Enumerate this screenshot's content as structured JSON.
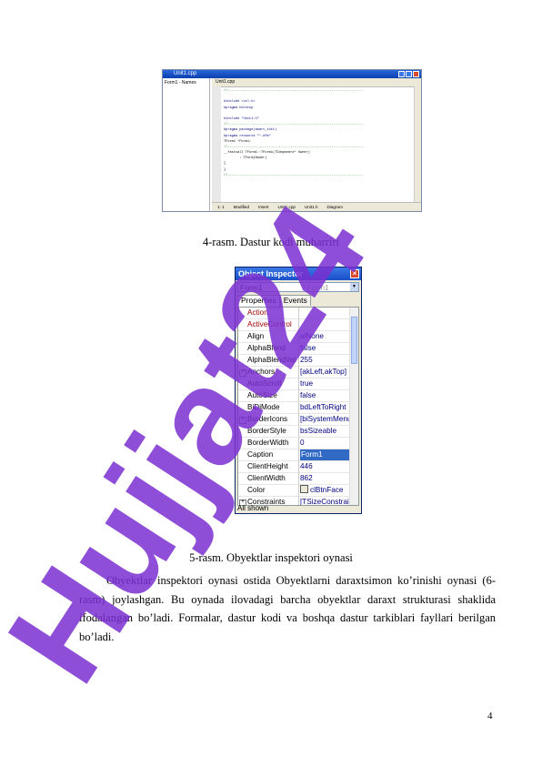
{
  "figure4": {
    "window_title": "Unit1.cpp",
    "tree_item": "Form1 - Names",
    "tab_label": "Unit1.cpp",
    "code_lines": [
      "//---------------------------------------------------------------------",
      "",
      "#include <vcl.h>",
      "#pragma hdrstop",
      "",
      "#include \"Unit1.h\"",
      "//---------------------------------------------------------------------",
      "#pragma package(smart_init)",
      "#pragma resource \"*.dfm\"",
      "TForm1 *Form1;",
      "//---------------------------------------------------------------------",
      "__fastcall TForm1::TForm1(TComponent* Owner)",
      "        : TForm(Owner)",
      "{",
      "}",
      "//---------------------------------------------------------------------"
    ],
    "status": [
      "1:  1",
      "Modified",
      "Insert",
      "Unit1.cpp",
      "Unit1.h",
      "Diagram"
    ]
  },
  "caption4": "4-rasm. Dastur kodi muharriri",
  "inspector": {
    "title": "Object Inspector",
    "close_glyph": "×",
    "object_name": "Form1",
    "object_type": "TForm1",
    "tabs": [
      "Properties",
      "Events"
    ],
    "rows": [
      {
        "name": "Action",
        "value": "",
        "event": true
      },
      {
        "name": "ActiveControl",
        "value": "",
        "event": true
      },
      {
        "name": "Align",
        "value": "alNone"
      },
      {
        "name": "AlphaBlend",
        "value": "false"
      },
      {
        "name": "AlphaBlendVal",
        "value": "255"
      },
      {
        "name": "Anchors",
        "value": "[akLeft,akTop]",
        "expand": true
      },
      {
        "name": "AutoScroll",
        "value": "true"
      },
      {
        "name": "AutoSize",
        "value": "false"
      },
      {
        "name": "BiDiMode",
        "value": "bdLeftToRight"
      },
      {
        "name": "BorderIcons",
        "value": "[biSystemMenu,",
        "expand": true
      },
      {
        "name": "BorderStyle",
        "value": "bsSizeable"
      },
      {
        "name": "BorderWidth",
        "value": "0"
      },
      {
        "name": "Caption",
        "value": "Form1",
        "selected": true
      },
      {
        "name": "ClientHeight",
        "value": "446"
      },
      {
        "name": "ClientWidth",
        "value": "862"
      },
      {
        "name": "Color",
        "value": "clBtnFace",
        "swatch": true
      },
      {
        "name": "Constraints",
        "value": "[TSizeConstrain",
        "expand": true
      }
    ],
    "status": "All shown"
  },
  "caption5": "5-rasm. Obyektlar inspektori oynasi",
  "paragraph": "Obyektlar inspektori oynasi ostida Obyektlarni daraxtsimon ko’rinishi oynasi (6-rasm) joylashgan. Bu oynada ilovadagi barcha obyektlar daraxt strukturasi shaklida ifodalangan bo’ladi. Formalar, dastur kodi va boshqa dastur tarkiblari fayllari berilgan bo’ladi.",
  "page_number": "4",
  "watermark": "Hujjat24",
  "colors": {
    "watermark": "#7b2fd0",
    "watermark_gray": "#9a9a9a",
    "titlebar": "#1a4fc8"
  }
}
